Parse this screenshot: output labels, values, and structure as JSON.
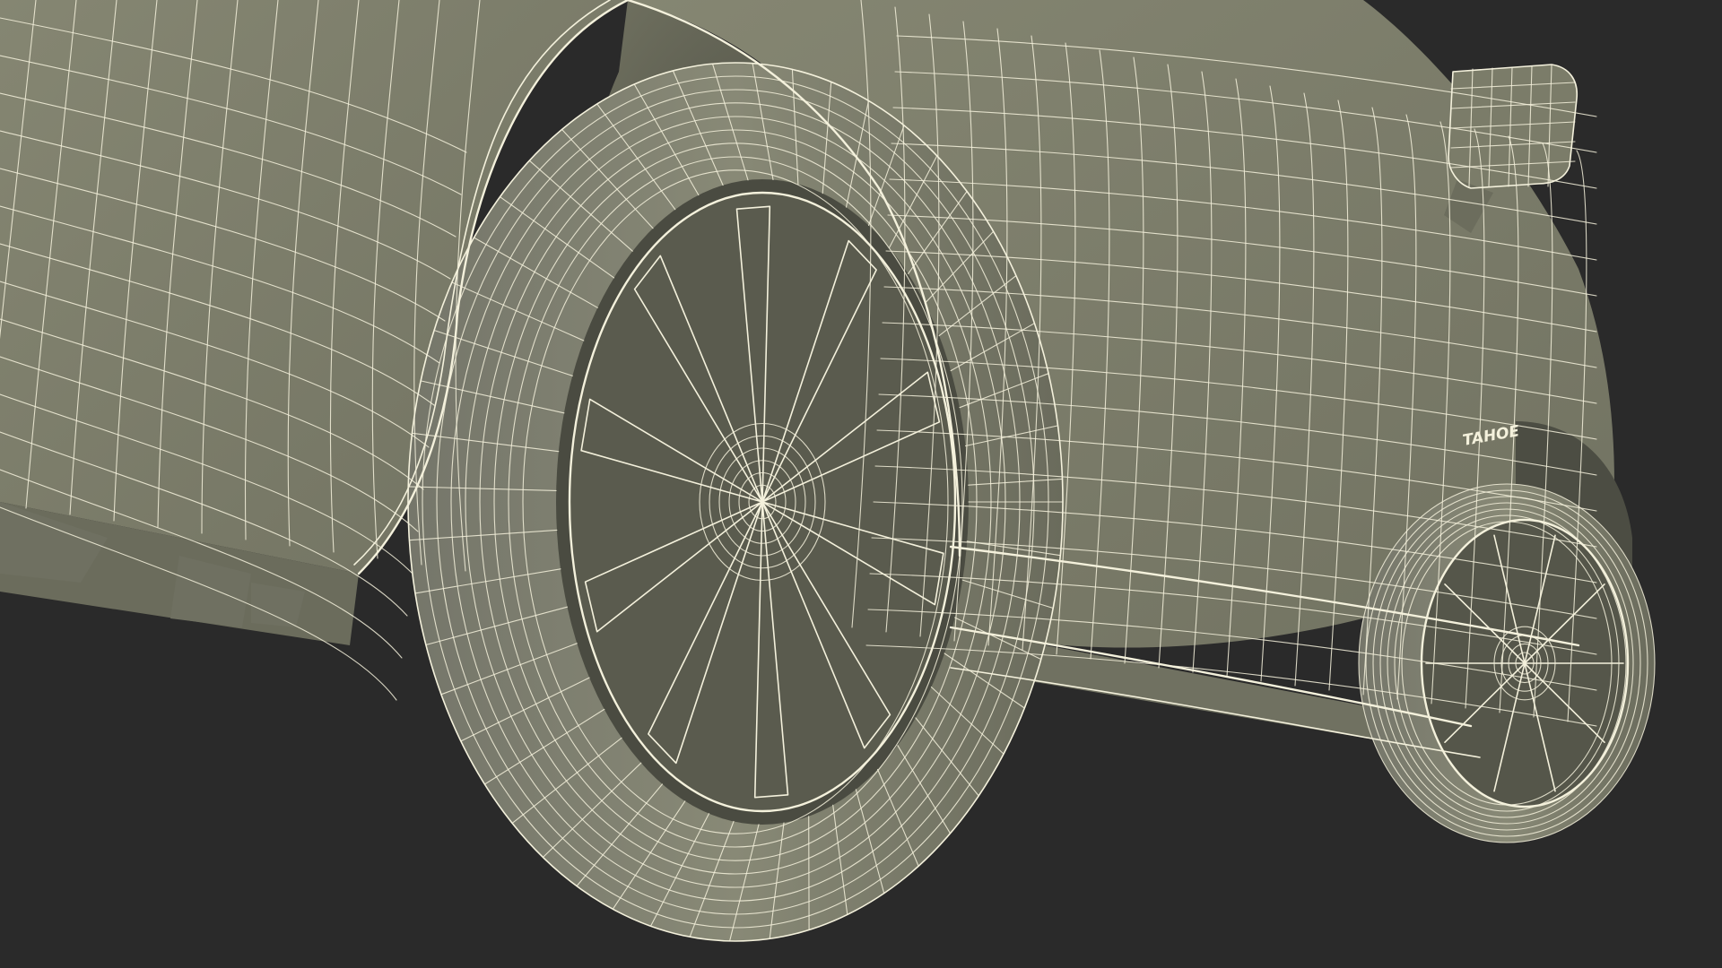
{
  "scene": {
    "badge_text": "TAHOE"
  },
  "colors": {
    "background": "#2a2a2a",
    "surface": "#7e7f6c",
    "surface_dark": "#5e5f52",
    "shadow": "#3b3c35",
    "wire": "#f4f1dc"
  }
}
